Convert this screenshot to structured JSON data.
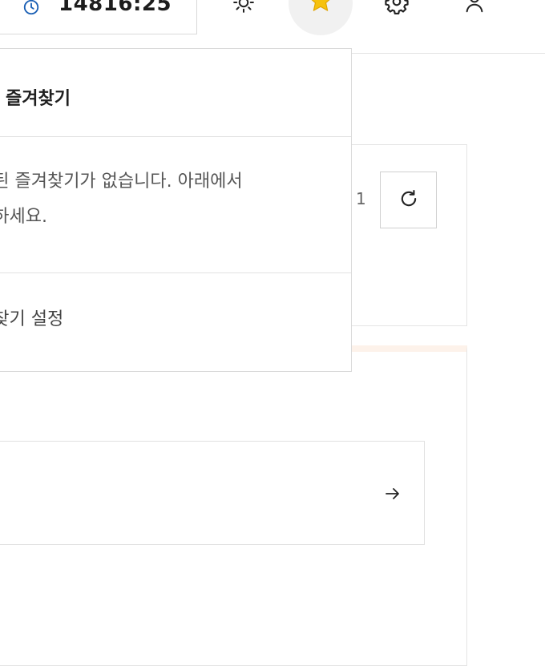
{
  "header": {
    "clock_text": "14816:25",
    "icons": [
      "clock-icon",
      "sun-icon",
      "star-icon",
      "gear-icon",
      "user-icon"
    ]
  },
  "favorites_dropdown": {
    "title": "즐겨찾기",
    "empty_line1": "록된 즐겨찾기가 없습니다. 아래에서",
    "empty_line2": "정하세요.",
    "settings_link": "겨찾기 설정"
  },
  "card": {
    "count": "1"
  },
  "colors": {
    "accent_blue": "#1a5fb4",
    "star_yellow": "#f6c20e",
    "card_highlight": "#fdf2ea"
  }
}
